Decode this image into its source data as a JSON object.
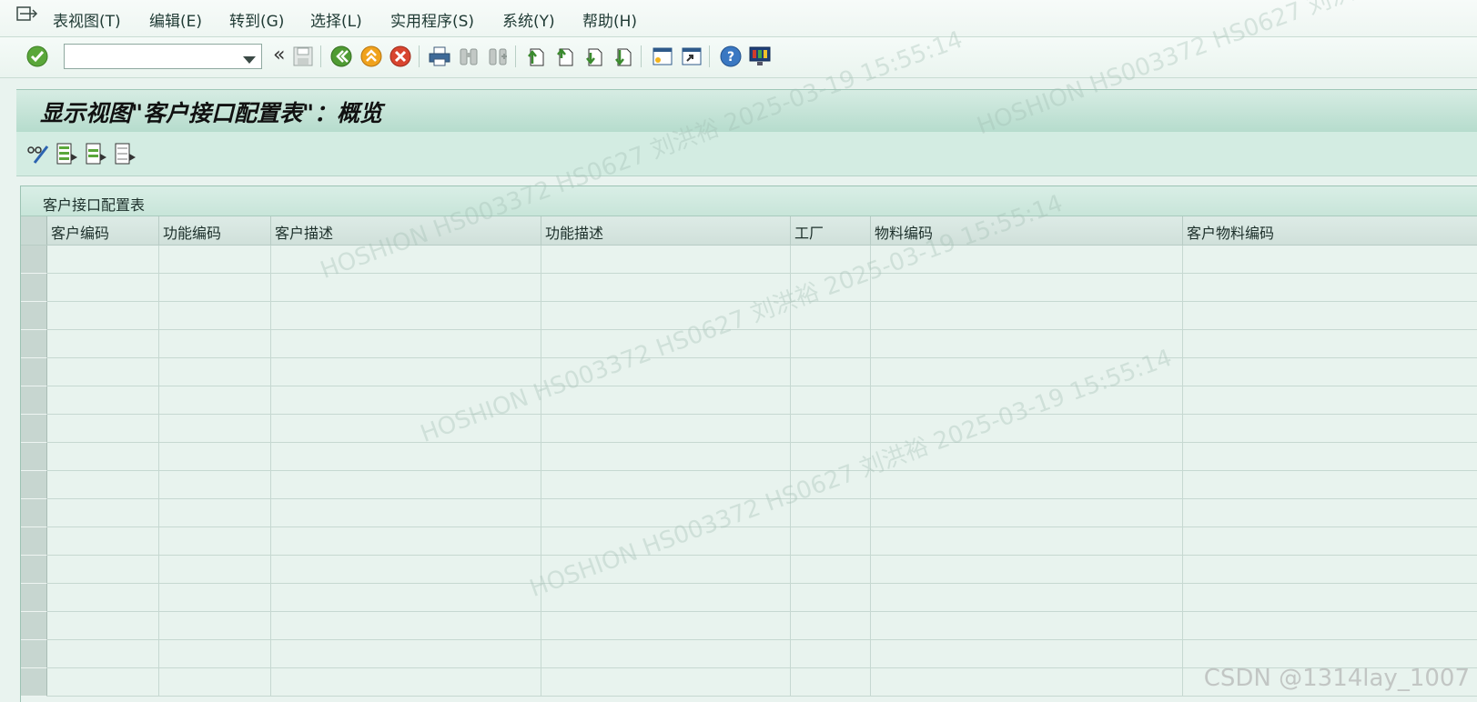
{
  "menu": {
    "items": [
      "表视图(T)",
      "编辑(E)",
      "转到(G)",
      "选择(L)",
      "实用程序(S)",
      "系统(Y)",
      "帮助(H)"
    ]
  },
  "toolbar": {
    "command_value": "",
    "icons": [
      "enter-icon",
      "command-dropdown-icon",
      "collapse-icon",
      "save-icon",
      "back-icon",
      "exit-icon",
      "cancel-icon",
      "print-icon",
      "find-icon",
      "find-next-icon",
      "first-page-icon",
      "previous-page-icon",
      "next-page-icon",
      "last-page-icon",
      "new-session-icon",
      "shortcut-icon",
      "help-icon",
      "layout-icon"
    ]
  },
  "page": {
    "title": "显示视图\"客户接口配置表\"：概览"
  },
  "app_toolbar": {
    "icons": [
      "display-change-icon",
      "select-all-icon",
      "select-block-icon",
      "deselect-all-icon"
    ]
  },
  "table": {
    "caption": "客户接口配置表",
    "columns": [
      "客户编码",
      "功能编码",
      "客户描述",
      "功能描述",
      "工厂",
      "物料编码",
      "客户物料编码"
    ],
    "row_count": 16
  },
  "watermark": {
    "texts": [
      "HOSHION",
      "HS003372 HS0627 刘洪裕",
      "2025-03-19 15:55:14"
    ]
  },
  "credit": "CSDN @1314lay_1007"
}
